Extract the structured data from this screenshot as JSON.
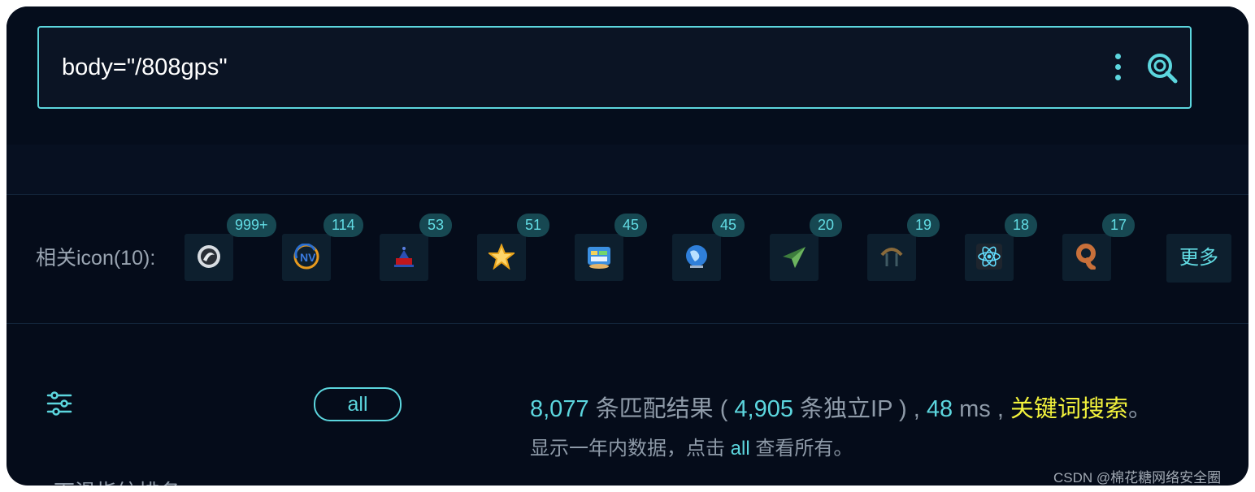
{
  "search": {
    "query": "body=\"/808gps\""
  },
  "icons_section": {
    "label": "相关icon(10):",
    "icons": [
      {
        "count": "999+",
        "icon": "ring-emblem-icon"
      },
      {
        "count": "114",
        "icon": "nv-logo-icon"
      },
      {
        "count": "53",
        "icon": "building-logo-icon"
      },
      {
        "count": "51",
        "icon": "star-icon"
      },
      {
        "count": "45",
        "icon": "window-app-icon"
      },
      {
        "count": "45",
        "icon": "globe-icon"
      },
      {
        "count": "20",
        "icon": "paper-plane-icon"
      },
      {
        "count": "19",
        "icon": "arch-icon"
      },
      {
        "count": "18",
        "icon": "atom-icon"
      },
      {
        "count": "17",
        "icon": "copper-hook-icon"
      }
    ],
    "more_label": "更多"
  },
  "filter": {
    "all_label": "all"
  },
  "results": {
    "match_count": "8,077",
    "match_text": " 条匹配结果 ( ",
    "ip_count": "4,905",
    "ip_text": " 条独立IP ) , ",
    "time_value": "48",
    "time_unit": " ms , ",
    "keyword_search": "关键词搜索",
    "end_punct": "。",
    "sub_prefix": "显示一年内数据，点击 ",
    "sub_all": "all",
    "sub_suffix": " 查看所有。"
  },
  "cut_text": "下滑指纹排名",
  "watermark": "CSDN @棉花糖网络安全圈",
  "colors": {
    "accent": "#5cd6de",
    "keyword": "#f2f23c",
    "background": "#050c1a"
  }
}
